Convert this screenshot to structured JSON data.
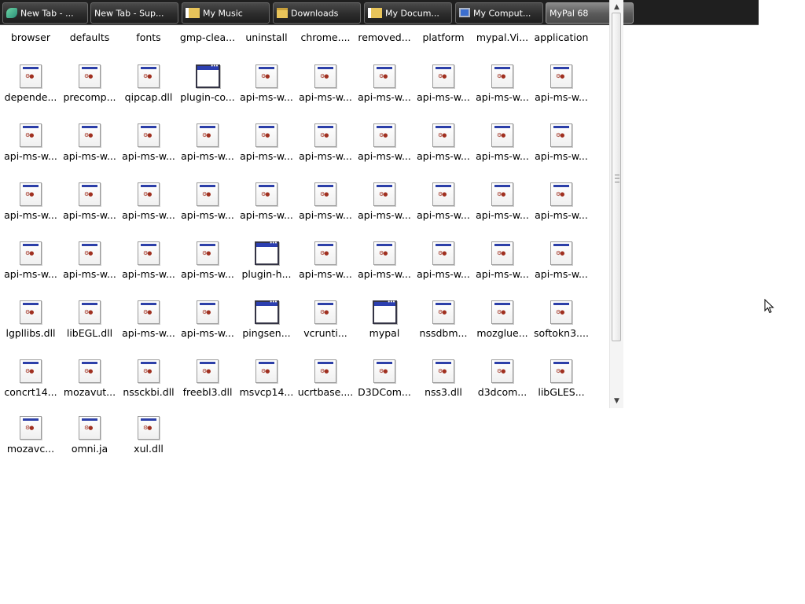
{
  "taskbar": {
    "items": [
      {
        "label": "New Tab - ...",
        "icon": "browser-icon"
      },
      {
        "label": "New Tab - Sup...",
        "icon": ""
      },
      {
        "label": "My Music",
        "icon": "folder-music-icon"
      },
      {
        "label": "Downloads",
        "icon": "folder-icon"
      },
      {
        "label": "My Docum...",
        "icon": "documents-icon"
      },
      {
        "label": "My Comput...",
        "icon": "computer-icon"
      },
      {
        "label": "MyPal 68",
        "icon": ""
      }
    ],
    "active_index": 6
  },
  "files": {
    "row0": [
      {
        "label": "browser"
      },
      {
        "label": "defaults"
      },
      {
        "label": "fonts"
      },
      {
        "label": "gmp-clea..."
      },
      {
        "label": "uninstall"
      },
      {
        "label": "chrome...."
      },
      {
        "label": "removed..."
      },
      {
        "label": "platform"
      },
      {
        "label": "mypal.Vi..."
      },
      {
        "label": "application"
      }
    ],
    "rows": [
      [
        {
          "label": "depende...",
          "type": "dll"
        },
        {
          "label": "precomp...",
          "type": "dll"
        },
        {
          "label": "qipcap.dll",
          "type": "dll"
        },
        {
          "label": "plugin-co...",
          "type": "exe"
        },
        {
          "label": "api-ms-w...",
          "type": "dll"
        },
        {
          "label": "api-ms-w...",
          "type": "dll"
        },
        {
          "label": "api-ms-w...",
          "type": "dll"
        },
        {
          "label": "api-ms-w...",
          "type": "dll"
        },
        {
          "label": "api-ms-w...",
          "type": "dll"
        },
        {
          "label": "api-ms-w...",
          "type": "dll"
        }
      ],
      [
        {
          "label": "api-ms-w...",
          "type": "dll"
        },
        {
          "label": "api-ms-w...",
          "type": "dll"
        },
        {
          "label": "api-ms-w...",
          "type": "dll"
        },
        {
          "label": "api-ms-w...",
          "type": "dll"
        },
        {
          "label": "api-ms-w...",
          "type": "dll"
        },
        {
          "label": "api-ms-w...",
          "type": "dll"
        },
        {
          "label": "api-ms-w...",
          "type": "dll"
        },
        {
          "label": "api-ms-w...",
          "type": "dll"
        },
        {
          "label": "api-ms-w...",
          "type": "dll"
        },
        {
          "label": "api-ms-w...",
          "type": "dll"
        }
      ],
      [
        {
          "label": "api-ms-w...",
          "type": "dll"
        },
        {
          "label": "api-ms-w...",
          "type": "dll"
        },
        {
          "label": "api-ms-w...",
          "type": "dll"
        },
        {
          "label": "api-ms-w...",
          "type": "dll"
        },
        {
          "label": "api-ms-w...",
          "type": "dll"
        },
        {
          "label": "api-ms-w...",
          "type": "dll"
        },
        {
          "label": "api-ms-w...",
          "type": "dll"
        },
        {
          "label": "api-ms-w...",
          "type": "dll"
        },
        {
          "label": "api-ms-w...",
          "type": "dll"
        },
        {
          "label": "api-ms-w...",
          "type": "dll"
        }
      ],
      [
        {
          "label": "api-ms-w...",
          "type": "dll"
        },
        {
          "label": "api-ms-w...",
          "type": "dll"
        },
        {
          "label": "api-ms-w...",
          "type": "dll"
        },
        {
          "label": "api-ms-w...",
          "type": "dll"
        },
        {
          "label": "plugin-h...",
          "type": "exe"
        },
        {
          "label": "api-ms-w...",
          "type": "dll"
        },
        {
          "label": "api-ms-w...",
          "type": "dll"
        },
        {
          "label": "api-ms-w...",
          "type": "dll"
        },
        {
          "label": "api-ms-w...",
          "type": "dll"
        },
        {
          "label": "api-ms-w...",
          "type": "dll"
        }
      ],
      [
        {
          "label": "lgpllibs.dll",
          "type": "dll"
        },
        {
          "label": "libEGL.dll",
          "type": "dll"
        },
        {
          "label": "api-ms-w...",
          "type": "dll"
        },
        {
          "label": "api-ms-w...",
          "type": "dll"
        },
        {
          "label": "pingsen...",
          "type": "exe"
        },
        {
          "label": "vcrunti...",
          "type": "dll"
        },
        {
          "label": "mypal",
          "type": "exe"
        },
        {
          "label": "nssdbm...",
          "type": "dll"
        },
        {
          "label": "mozglue...",
          "type": "dll"
        },
        {
          "label": "softokn3....",
          "type": "dll"
        }
      ],
      [
        {
          "label": "concrt14...",
          "type": "dll"
        },
        {
          "label": "mozavut...",
          "type": "dll"
        },
        {
          "label": "nssckbi.dll",
          "type": "dll"
        },
        {
          "label": "freebl3.dll",
          "type": "dll"
        },
        {
          "label": "msvcp14...",
          "type": "dll"
        },
        {
          "label": "ucrtbase....",
          "type": "dll"
        },
        {
          "label": "D3DCom...",
          "type": "dll"
        },
        {
          "label": "nss3.dll",
          "type": "dll"
        },
        {
          "label": "d3dcom...",
          "type": "dll"
        },
        {
          "label": "libGLES...",
          "type": "dll"
        }
      ],
      [
        {
          "label": "mozavc...",
          "type": "dll"
        },
        {
          "label": "omni.ja",
          "type": "dll"
        },
        {
          "label": "xul.dll",
          "type": "dll"
        }
      ]
    ]
  },
  "scrollbar": {
    "up_arrow": "▲",
    "down_arrow": "▼",
    "position": 0.0
  }
}
